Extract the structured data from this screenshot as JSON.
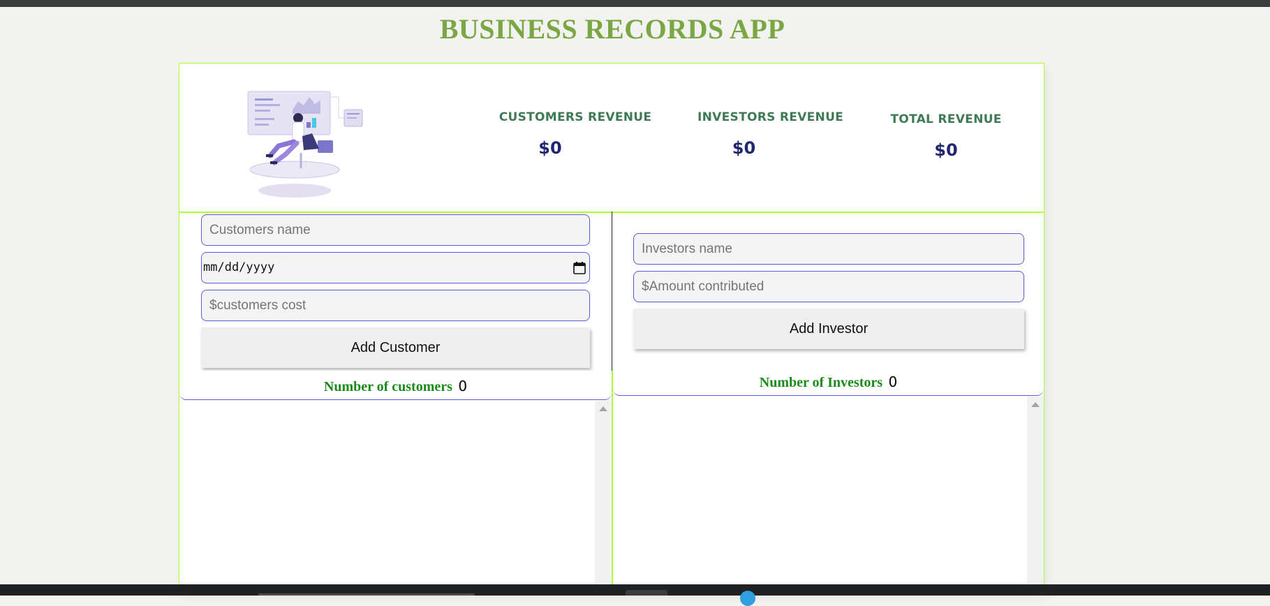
{
  "app": {
    "title": "BUSINESS RECORDS APP"
  },
  "stats": {
    "customers_revenue": {
      "label": "CUSTOMERS REVENUE",
      "value": "$0"
    },
    "investors_revenue": {
      "label": "INVESTORS REVENUE",
      "value": "$0"
    },
    "total_revenue": {
      "label": "TOTAL REVENUE",
      "value": "$0"
    }
  },
  "customer_form": {
    "name_placeholder": "Customers name",
    "date_placeholder": "mm/dd/yyyy",
    "cost_placeholder": "$customers cost",
    "submit_label": "Add Customer"
  },
  "investor_form": {
    "name_placeholder": "Investors name",
    "amount_placeholder": "$Amount contributed",
    "submit_label": "Add Investor"
  },
  "customers_list": {
    "count_label": "Number of customers",
    "count": "0"
  },
  "investors_list": {
    "count_label": "Number of Investors",
    "count": "0"
  },
  "colors": {
    "accent_green": "#adff2f",
    "title_green": "#7aa643",
    "stat_green": "#3e7a55",
    "value_navy": "#22266e",
    "input_border": "#5b5bd6"
  }
}
